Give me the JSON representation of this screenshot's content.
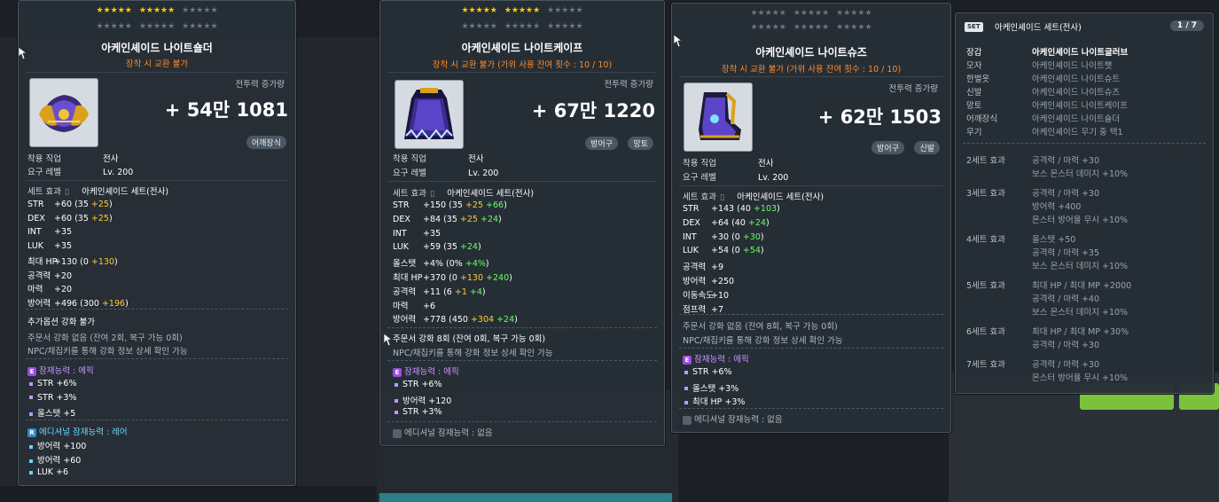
{
  "cards": [
    {
      "stars": {
        "gold_first": 5,
        "gold_second": 5,
        "empty_third": 5,
        "row2": 0
      },
      "name": "아케인셰이드 나이트숄더",
      "sub": "장착 시 교환 불가",
      "cp_label": "전투력 증가량",
      "cp_value": "+ 54만 1081",
      "tags": [
        "어깨장식"
      ],
      "req_job_label": "착용 직업",
      "req_job": "전사",
      "req_lv_label": "요구 레벨",
      "req_lv": "Lv. 200",
      "set_label": "세트 효과",
      "set_name": "아케인셰이드 세트(전사)",
      "stats": [
        {
          "k": "STR",
          "v": "+60",
          "base": "(35",
          "a": "+25",
          "b": "",
          "end": ")"
        },
        {
          "k": "DEX",
          "v": "+60",
          "base": "(35",
          "a": "+25",
          "b": "",
          "end": ")"
        },
        {
          "k": "INT",
          "v": "+35"
        },
        {
          "k": "LUK",
          "v": "+35"
        },
        {
          "k": "최대 HP",
          "v": "+130",
          "base": "(0",
          "a": "+130",
          "b": "",
          "end": ")"
        },
        {
          "k": "공격력",
          "v": "+20"
        },
        {
          "k": "마력",
          "v": "+20"
        },
        {
          "k": "방어력",
          "v": "+496",
          "base": "(300",
          "a": "+196",
          "b": "",
          "end": ")"
        }
      ],
      "extra": "추가옵션 강화 불가",
      "scroll": "주문서 강화 없음 (잔여 2회, 복구 가능 0회)",
      "npc": "NPC/채집키를 통해 강화 정보 상세 확인 가능",
      "pot_label": "잠재능력 : 에픽",
      "pot": [
        "STR +6%",
        "STR +3%",
        "올스탯 +5"
      ],
      "addpot_label": "에디셔널 잠재능력 : 레어",
      "addpot": [
        "방어력 +100",
        "방어력 +60",
        "LUK +6"
      ]
    },
    {
      "name": "아케인셰이드 나이트케이프",
      "sub": "장착 시 교환 불가 (가위 사용 잔여 횟수 : 10 / 10)",
      "cp_label": "전투력 증가량",
      "cp_value": "+ 67만 1220",
      "tags": [
        "방어구",
        "망토"
      ],
      "req_job_label": "착용 직업",
      "req_job": "전사",
      "req_lv_label": "요구 레벨",
      "req_lv": "Lv. 200",
      "set_label": "세트 효과",
      "set_name": "아케인셰이드 세트(전사)",
      "stats": [
        {
          "k": "STR",
          "v": "+150",
          "base": "(35",
          "a": "+25",
          "b": "+66",
          "end": ")"
        },
        {
          "k": "DEX",
          "v": "+84",
          "base": "(35",
          "a": "+25",
          "b": "+24",
          "end": ")"
        },
        {
          "k": "INT",
          "v": "+35"
        },
        {
          "k": "LUK",
          "v": "+59",
          "base": "(35",
          "a": "",
          "b": "+24",
          "end": ")"
        },
        {
          "k": "올스탯",
          "v": "+4%",
          "base": "(0%",
          "a": "",
          "b": "+4%",
          "end": ")"
        },
        {
          "k": "최대 HP",
          "v": "+370",
          "base": "(0",
          "a": "+130",
          "b": "+240",
          "end": ")"
        },
        {
          "k": "공격력",
          "v": "+11",
          "base": "(6",
          "a": "+1",
          "b": "+4",
          "end": ")"
        },
        {
          "k": "마력",
          "v": "+6"
        },
        {
          "k": "방어력",
          "v": "+778",
          "base": "(450",
          "a": "+304",
          "b": "+24",
          "end": ")"
        }
      ],
      "scroll": "주문서 강화 8회 (잔여 0회, 복구 가능 0회)",
      "npc": "NPC/채집키를 통해 강화 정보 상세 확인 가능",
      "pot_label": "잠재능력 : 에픽",
      "pot": [
        "STR +6%",
        "방어력 +120",
        "STR +3%"
      ],
      "addpot_label": "에디셔널 잠재능력 : 없음"
    },
    {
      "name": "아케인셰이드 나이트슈즈",
      "sub": "장착 시 교환 불가 (가위 사용 잔여 횟수 : 10 / 10)",
      "cp_label": "전투력 증가량",
      "cp_value": "+ 62만 1503",
      "tags": [
        "방어구",
        "신발"
      ],
      "req_job_label": "착용 직업",
      "req_job": "전사",
      "req_lv_label": "요구 레벨",
      "req_lv": "Lv. 200",
      "set_label": "세트 효과",
      "set_name": "아케인셰이드 세트(전사)",
      "stats": [
        {
          "k": "STR",
          "v": "+143",
          "base": "(40",
          "a": "",
          "b": "+103",
          "end": ")"
        },
        {
          "k": "DEX",
          "v": "+64",
          "base": "(40",
          "a": "",
          "b": "+24",
          "end": ")"
        },
        {
          "k": "INT",
          "v": "+30",
          "base": "(0",
          "a": "",
          "b": "+30",
          "end": ")"
        },
        {
          "k": "LUK",
          "v": "+54",
          "base": "(0",
          "a": "",
          "b": "+54",
          "end": ")"
        },
        {
          "k": "공격력",
          "v": "+9"
        },
        {
          "k": "방어력",
          "v": "+250"
        },
        {
          "k": "이동속도",
          "v": "+10"
        },
        {
          "k": "점프력",
          "v": "+7"
        }
      ],
      "scroll": "주문서 강화 없음 (잔여 8회, 복구 가능 0회)",
      "npc": "NPC/채집키를 통해 강화 정보 상세 확인 가능",
      "pot_label": "잠재능력 : 에픽",
      "pot": [
        "STR +6%",
        "올스탯 +3%",
        "최대 HP +3%"
      ],
      "addpot_label": "에디셔널 잠재능력 : 없음"
    }
  ],
  "set_panel": {
    "badge": "SET",
    "title": "아케인셰이드 세트(전사)",
    "page": "1 / 7",
    "items": [
      {
        "k": "장갑",
        "v": "아케인셰이드 나이트글러브",
        "on": true
      },
      {
        "k": "모자",
        "v": "아케인셰이드 나이트햇",
        "on": false
      },
      {
        "k": "한벌옷",
        "v": "아케인셰이드 나이트슈트",
        "on": false
      },
      {
        "k": "신발",
        "v": "아케인셰이드 나이트슈즈",
        "on": false
      },
      {
        "k": "망토",
        "v": "아케인셰이드 나이트케이프",
        "on": false
      },
      {
        "k": "어깨장식",
        "v": "아케인셰이드 나이트숄더",
        "on": false
      },
      {
        "k": "무기",
        "v": "아케인셰이드 무기 중 택1",
        "on": false
      }
    ],
    "effects": [
      {
        "k": "2세트 효과",
        "lines": [
          "공격력 / 마력 +30",
          "보스 몬스터 데미지 +10%"
        ]
      },
      {
        "k": "3세트 효과",
        "lines": [
          "공격력 / 마력 +30",
          "방어력 +400",
          "몬스터 방어율 무시 +10%"
        ]
      },
      {
        "k": "4세트 효과",
        "lines": [
          "올스탯 +50",
          "공격력 / 마력 +35",
          "보스 몬스터 데미지 +10%"
        ]
      },
      {
        "k": "5세트 효과",
        "lines": [
          "최대 HP / 최대 MP +2000",
          "공격력 / 마력 +40",
          "보스 몬스터 데미지 +10%"
        ]
      },
      {
        "k": "6세트 효과",
        "lines": [
          "최대 HP / 최대 MP +30%",
          "공격력 / 마력 +30"
        ]
      },
      {
        "k": "7세트 효과",
        "lines": [
          "공격력 / 마력 +30",
          "몬스터 방어율 무시 +10%"
        ]
      }
    ]
  },
  "colors": {
    "star": "#ffcc00",
    "bonus_yellow": "#ffcc33",
    "bonus_green": "#66ff66",
    "epic": "#9b4be0",
    "rare": "#2e8ccf"
  }
}
